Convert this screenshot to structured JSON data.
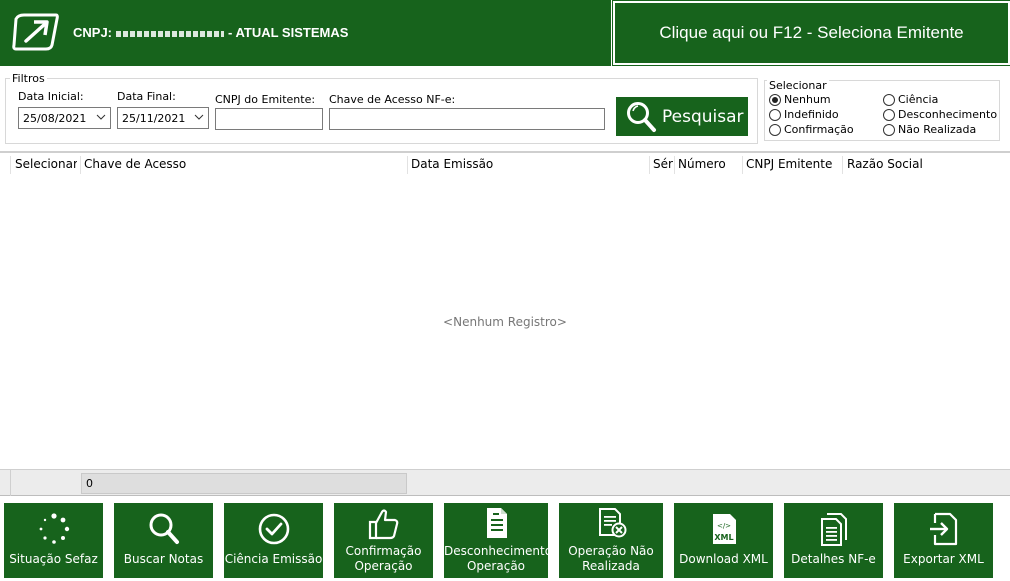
{
  "header": {
    "cnpj_label": "CNPJ:",
    "company": "- ATUAL SISTEMAS",
    "select_emitter_button": "Clique aqui ou F12 - Seleciona Emitente"
  },
  "filters": {
    "group_title": "Filtros",
    "start_date_label": "Data Inicial:",
    "start_date_value": "25/08/2021",
    "end_date_label": "Data Final:",
    "end_date_value": "25/11/2021",
    "cnpj_label": "CNPJ do Emitente:",
    "cnpj_value": "",
    "key_label": "Chave de Acesso NF-e:",
    "key_value": "",
    "search_button": "Pesquisar"
  },
  "select_group": {
    "title": "Selecionar",
    "options": [
      "Nenhum",
      "Ciência",
      "Indefinido",
      "Desconhecimento",
      "Confirmação",
      "Não Realizada"
    ],
    "selected": "Nenhum"
  },
  "grid": {
    "columns": [
      "Selecionar",
      "Chave de Acesso",
      "Data Emissão",
      "Sér",
      "Número",
      "CNPJ Emitente",
      "Razão Social"
    ],
    "empty_text": "<Nenhum Registro>",
    "footer_count": "0"
  },
  "actions": [
    {
      "label": "Situação Sefaz",
      "icon": "loading-icon"
    },
    {
      "label": "Buscar Notas",
      "icon": "search-icon"
    },
    {
      "label": "Ciência Emissão",
      "icon": "check-circle-icon"
    },
    {
      "label": "Confirmação Operação",
      "icon": "thumbs-up-icon"
    },
    {
      "label": "Desconhecimento Operação",
      "icon": "document-icon"
    },
    {
      "label": "Operação Não Realizada",
      "icon": "document-cancel-icon"
    },
    {
      "label": "Download XML",
      "icon": "xml-file-icon"
    },
    {
      "label": "Detalhes NF-e",
      "icon": "documents-icon"
    },
    {
      "label": "Exportar XML",
      "icon": "export-icon"
    }
  ],
  "colors": {
    "brand_green": "#17631c"
  }
}
